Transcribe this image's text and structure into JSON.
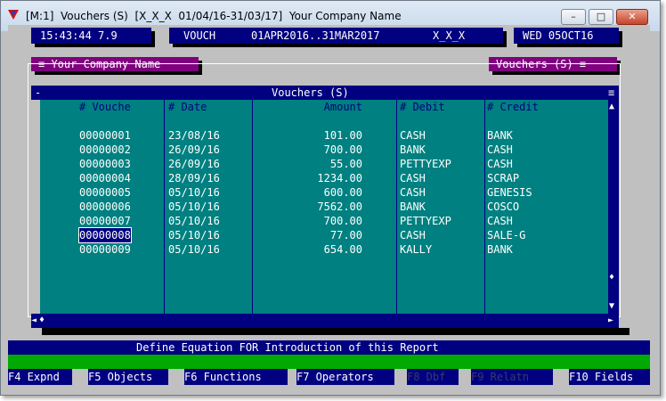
{
  "window": {
    "title": "[M:1]  Vouchers (S)  [X_X_X  01/04/16-31/03/17]  Your Company Name",
    "minimize_glyph": "–",
    "maximize_glyph": "□",
    "close_glyph": "✕"
  },
  "status": {
    "time": "15:43:44 7.9",
    "mode": "VOUCH",
    "period": "01APR2016..31MAR2017",
    "code": "X_X_X",
    "date": "WED 05OCT16"
  },
  "panels": {
    "left_tag": "≡ Your Company Name",
    "right_tag": "Vouchers (S) ≡"
  },
  "table": {
    "title": "Vouchers (S)",
    "menu_glyph": "-",
    "columns": [
      "# Vouche",
      "# Date",
      "Amount",
      "# Debit",
      "# Credit"
    ],
    "rows": [
      [
        "00000001",
        "23/08/16",
        "101.00",
        "CASH",
        "BANK"
      ],
      [
        "00000002",
        "26/09/16",
        "700.00",
        "BANK",
        "CASH"
      ],
      [
        "00000003",
        "26/09/16",
        "55.00",
        "PETTYEXP",
        "CASH"
      ],
      [
        "00000004",
        "28/09/16",
        "1234.00",
        "CASH",
        "SCRAP"
      ],
      [
        "00000005",
        "05/10/16",
        "600.00",
        "CASH",
        "GENESIS"
      ],
      [
        "00000006",
        "05/10/16",
        "7562.00",
        "BANK",
        "COSCO"
      ],
      [
        "00000007",
        "05/10/16",
        "700.00",
        "PETTYEXP",
        "CASH"
      ],
      [
        "00000008",
        "05/10/16",
        "77.00",
        "CASH",
        "SALE-G"
      ],
      [
        "00000009",
        "05/10/16",
        "654.00",
        "KALLY",
        "BANK"
      ]
    ],
    "selected_row": 7,
    "scroll_up": "▲",
    "scroll_down": "▼",
    "scroll_left": "◄",
    "scroll_right": "►",
    "scroll_thumb": "♦",
    "corner_glyph": "≡"
  },
  "message": "Define Equation FOR Introduction of this Report",
  "function_keys": [
    {
      "label": "F4 Expnd",
      "enabled": true
    },
    {
      "label": "F5 Objects",
      "enabled": true
    },
    {
      "label": "F6 Functions",
      "enabled": true
    },
    {
      "label": "F7 Operators",
      "enabled": true
    },
    {
      "label": "F8 Dbf",
      "enabled": false
    },
    {
      "label": "F9 Relatn",
      "enabled": false
    },
    {
      "label": "F10 Fields",
      "enabled": true
    }
  ],
  "colors": {
    "navy": "#000080",
    "teal": "#008080",
    "purple": "#800080",
    "green": "#00aa00",
    "gray": "#c0c0c0"
  }
}
